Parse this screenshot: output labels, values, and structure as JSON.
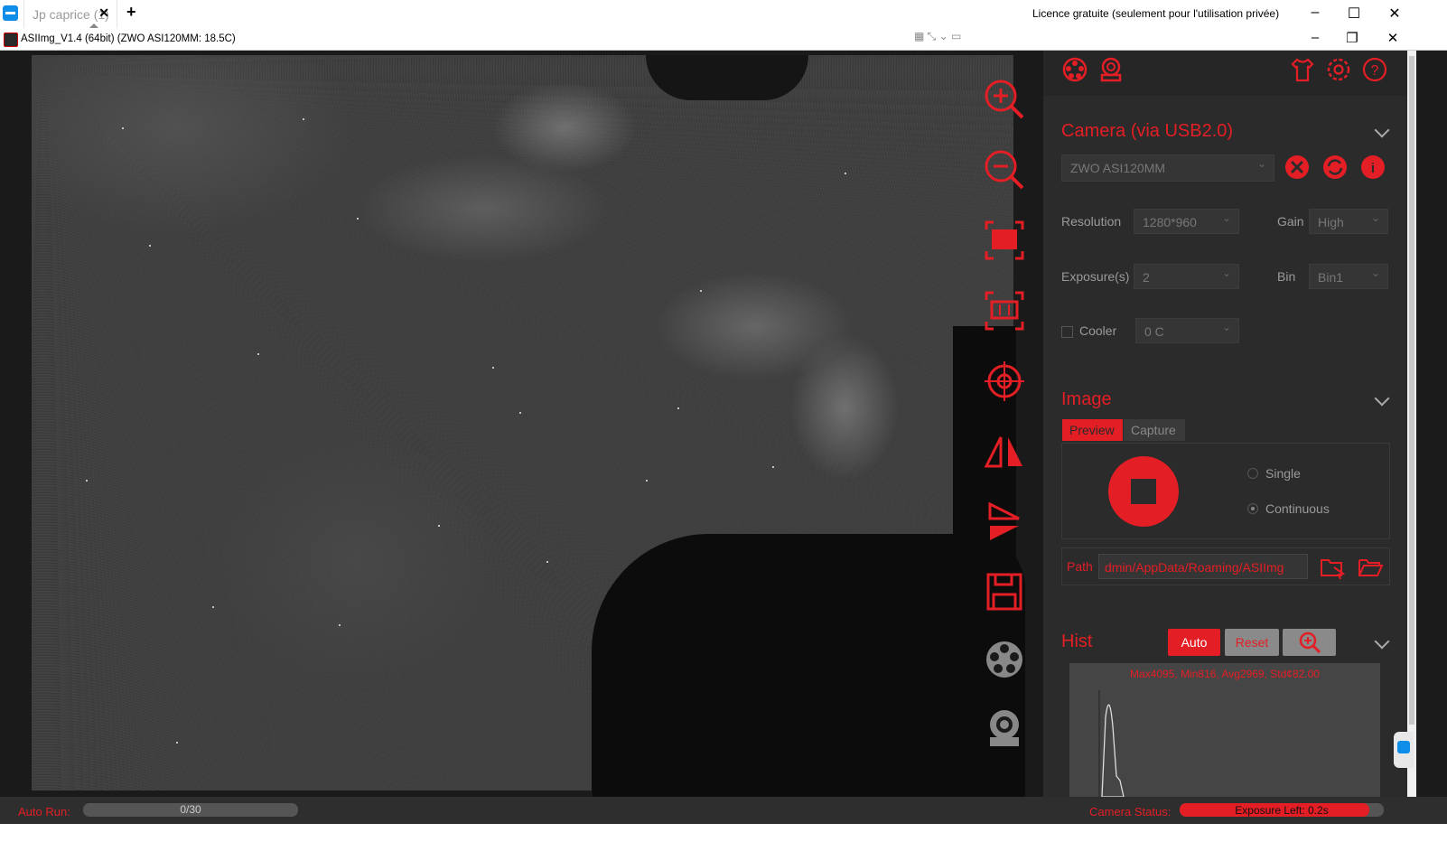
{
  "tabbar": {
    "tab_label": "Jp caprice (1)",
    "tab_close": "✕",
    "new_tab": "+",
    "licence": "Licence gratuite (seulement pour l'utilisation privée)",
    "minimize": "–",
    "maximize": "☐",
    "close": "✕"
  },
  "app": {
    "title": "ASIImg_V1.4 (64bit)  (ZWO ASI120MM: 18.5C)",
    "minimize": "–",
    "restore": "❐",
    "close": "✕"
  },
  "toolbar": {
    "tools": [
      "zoom-in-icon",
      "zoom-out-icon",
      "fit-screen-icon",
      "actual-size-icon",
      "crosshair-icon",
      "flip-horizontal-icon",
      "flip-vertical-icon",
      "save-icon",
      "filter-wheel-icon",
      "camera-icon"
    ]
  },
  "camera": {
    "section_title": "Camera (via USB2.0)",
    "device": "ZWO ASI120MM",
    "resolution_label": "Resolution",
    "resolution_value": "1280*960",
    "gain_label": "Gain",
    "gain_value": "High",
    "exposure_label": "Exposure(s)",
    "exposure_value": "2",
    "bin_label": "Bin",
    "bin_value": "Bin1",
    "cooler_label": "Cooler",
    "cooler_value": "0 C"
  },
  "image": {
    "section_title": "Image",
    "tab_preview": "Preview",
    "tab_capture": "Capture",
    "mode_single": "Single",
    "mode_continuous": "Continuous",
    "path_label": "Path",
    "path_value": "dmin/AppData/Roaming/ASIImg"
  },
  "hist": {
    "section_title": "Hist",
    "auto_label": "Auto",
    "reset_label": "Reset",
    "stats": "Max4095, Min816, Avg2969, Std¢82.00"
  },
  "status": {
    "auto_run_label": "Auto Run:",
    "auto_run_progress": "0/30",
    "camera_status_label": "Camera Status:",
    "exposure_left": "Exposure Left: 0.2s",
    "exposure_fraction": 0.93
  },
  "colors": {
    "accent": "#e41e25",
    "panel_bg": "#2b2b2b"
  }
}
